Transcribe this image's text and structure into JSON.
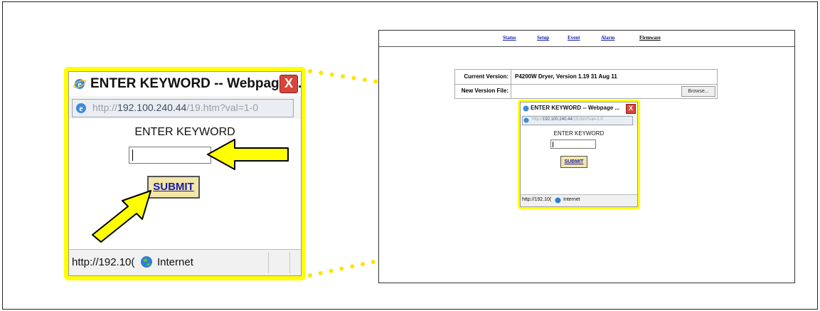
{
  "accent_color": "#ffff00",
  "popup": {
    "title": "ENTER KEYWORD -- Webpage ...",
    "address_prefix": "http://",
    "address_host": "192.100.240.44",
    "address_path": "/19.htm?val=1-0",
    "heading": "ENTER KEYWORD",
    "input_value": "",
    "submit_label": "SUBMIT",
    "status_url": "http://192.10(",
    "status_zone": "Internet",
    "close_glyph": "X"
  },
  "browser": {
    "nav": [
      "Status",
      "Setup",
      "Event",
      "Alarm",
      "Firmware"
    ],
    "active_nav": "Firmware",
    "table": {
      "current_version_label": "Current Version:",
      "current_version_value": "P4200W Dryer, Version 1.19 31 Aug 11",
      "new_file_label": "New Version File:",
      "browse_label": "Browse..."
    }
  },
  "icons": {
    "ie_logo": "ie-logo-icon",
    "close": "close-icon",
    "globe": "globe-icon",
    "arrow": "arrow-icon"
  }
}
